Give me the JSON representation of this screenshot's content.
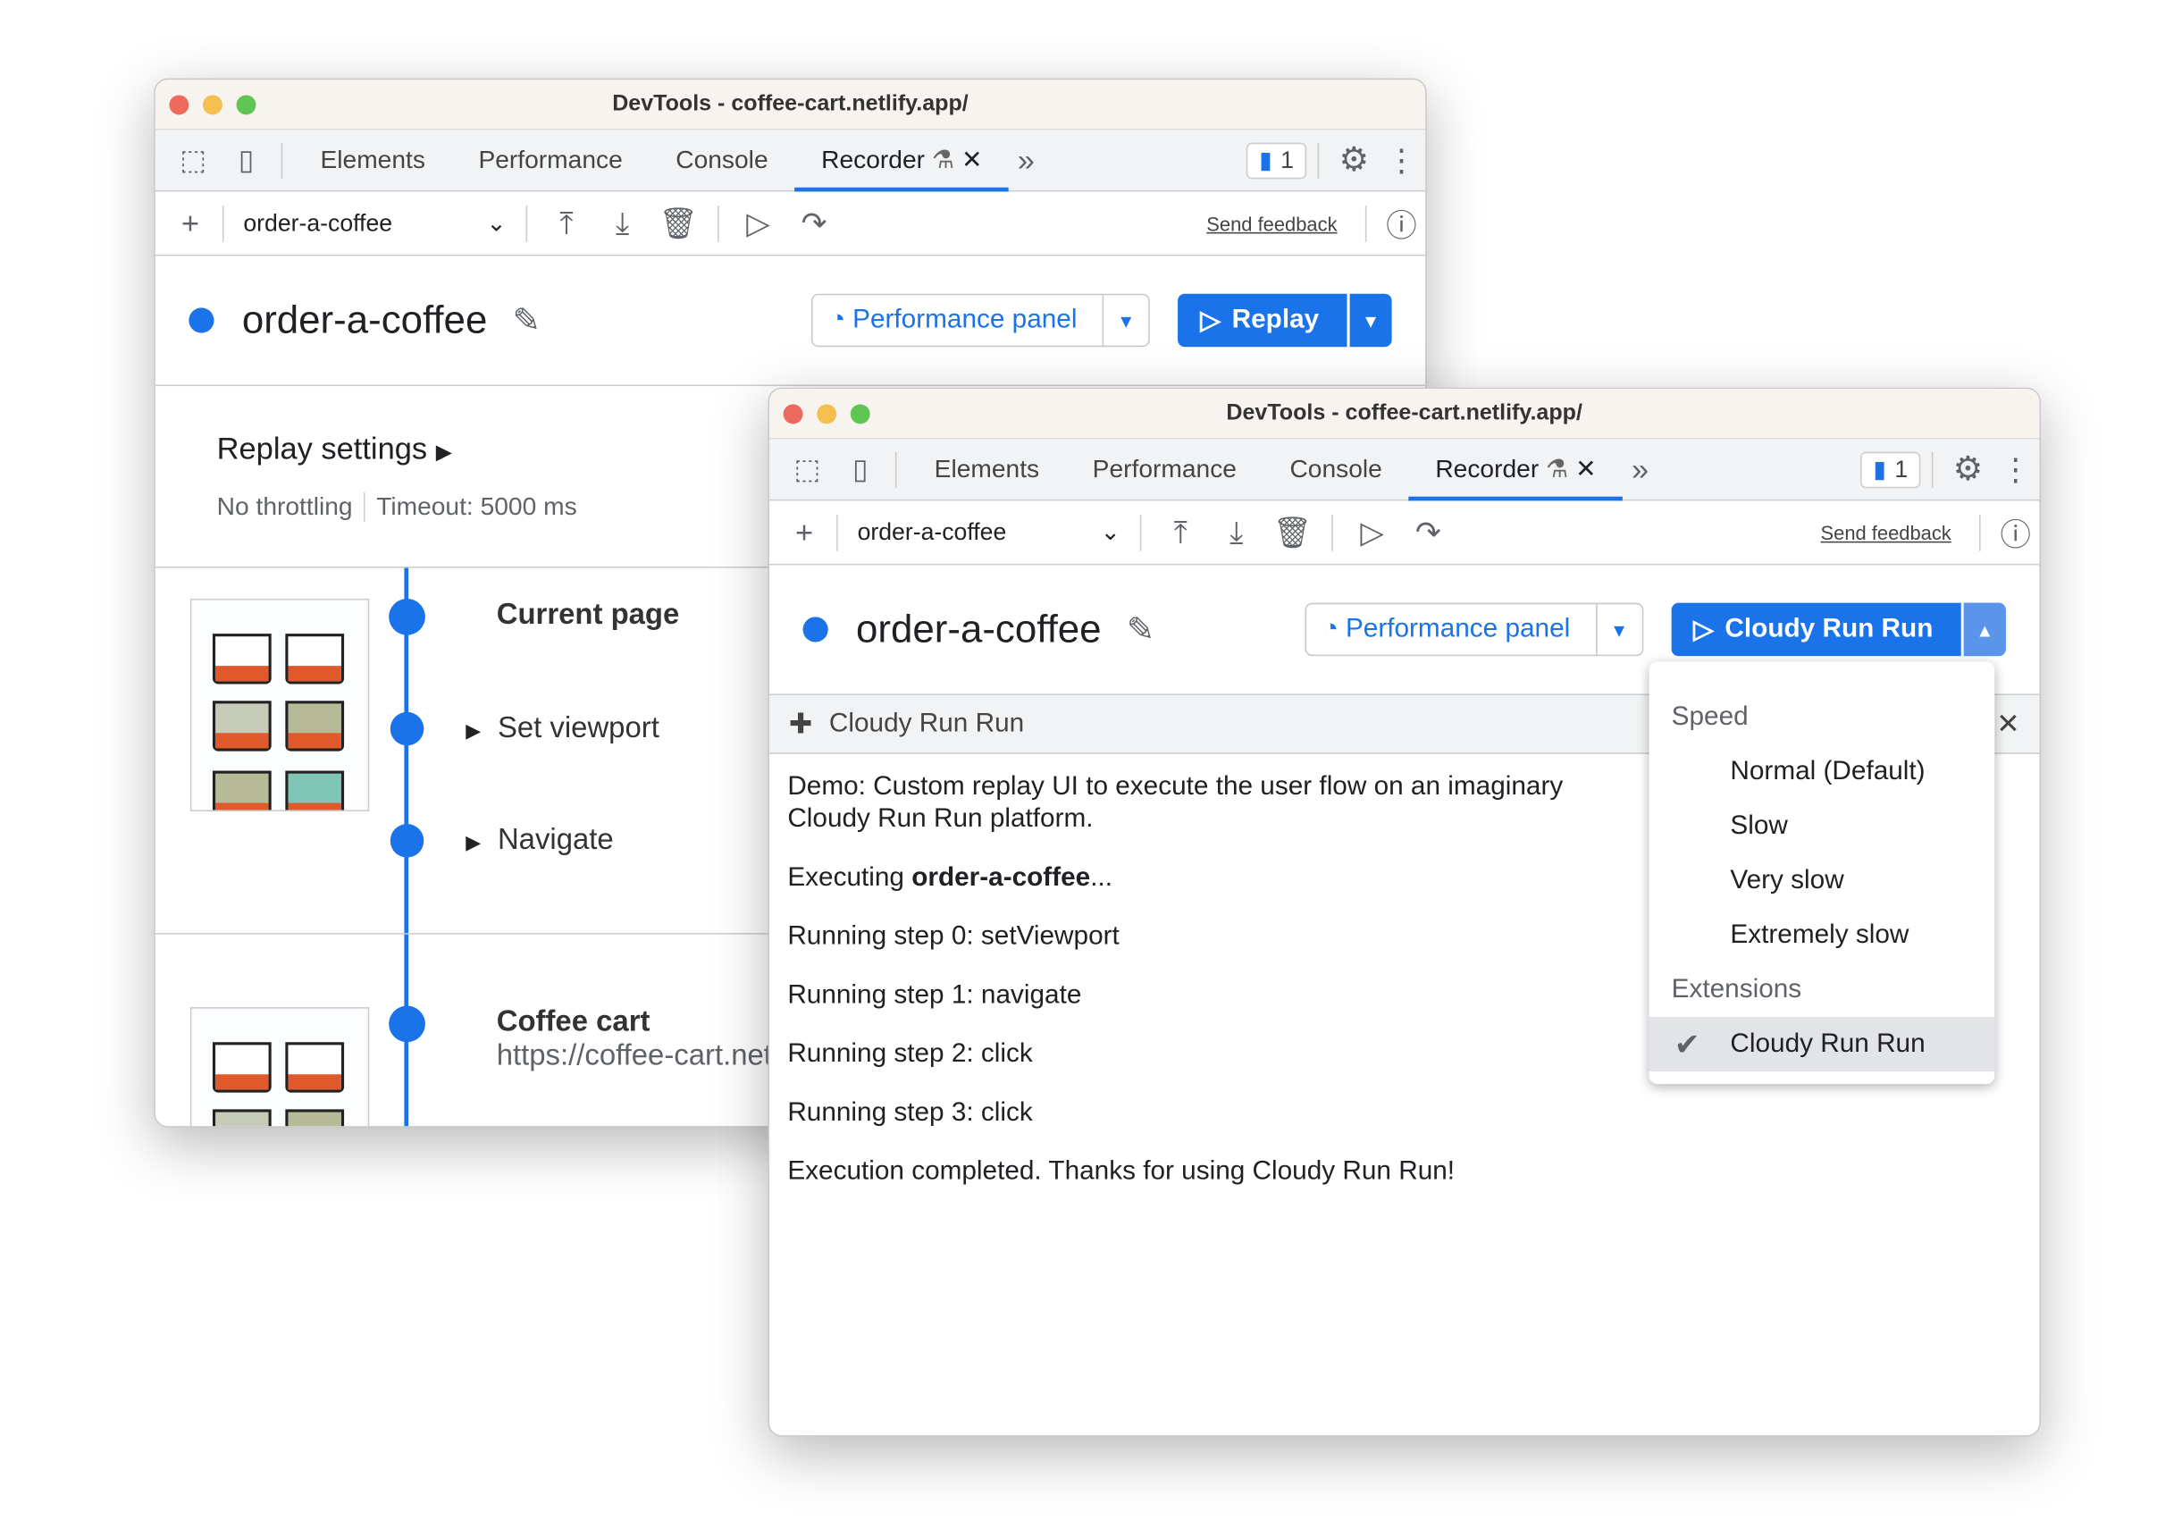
{
  "window_title": "DevTools - coffee-cart.netlify.app/",
  "tabs": [
    "Elements",
    "Performance",
    "Console",
    "Recorder"
  ],
  "issues_count": "1",
  "recording_select": "order-a-coffee",
  "send_feedback": "Send feedback",
  "recording_name": "order-a-coffee",
  "performance_panel": "Performance panel",
  "back_window": {
    "replay_label": "Replay",
    "replay_settings": "Replay settings",
    "throttling": "No throttling",
    "timeout": "Timeout: 5000 ms",
    "steps": [
      {
        "title": "Current page"
      },
      {
        "title": "Set viewport"
      },
      {
        "title": "Navigate"
      },
      {
        "title": "Coffee cart",
        "url": "https://coffee-cart.netlify.app/"
      }
    ]
  },
  "front_window": {
    "replay_label": "Cloudy Run Run",
    "extension_name": "Cloudy Run Run",
    "output": {
      "intro": "Demo: Custom replay UI to execute the user flow on an imaginary Cloudy Run Run platform.",
      "executing_prefix": "Executing ",
      "executing_name": "order-a-coffee",
      "executing_suffix": "...",
      "lines": [
        "Running step 0: setViewport",
        "Running step 1: navigate",
        "Running step 2: click",
        "Running step 3: click",
        "Execution completed. Thanks for using Cloudy Run Run!"
      ]
    },
    "menu": {
      "speed_label": "Speed",
      "speed_options": [
        "Normal (Default)",
        "Slow",
        "Very slow",
        "Extremely slow"
      ],
      "extensions_label": "Extensions",
      "extension_options": [
        {
          "label": "Cloudy Run Run",
          "checked": true
        }
      ]
    }
  },
  "colors": {
    "accent": "#1a73e8",
    "close": "#ed6a5e",
    "minimize": "#f5bf4f",
    "maximize": "#61c554"
  }
}
